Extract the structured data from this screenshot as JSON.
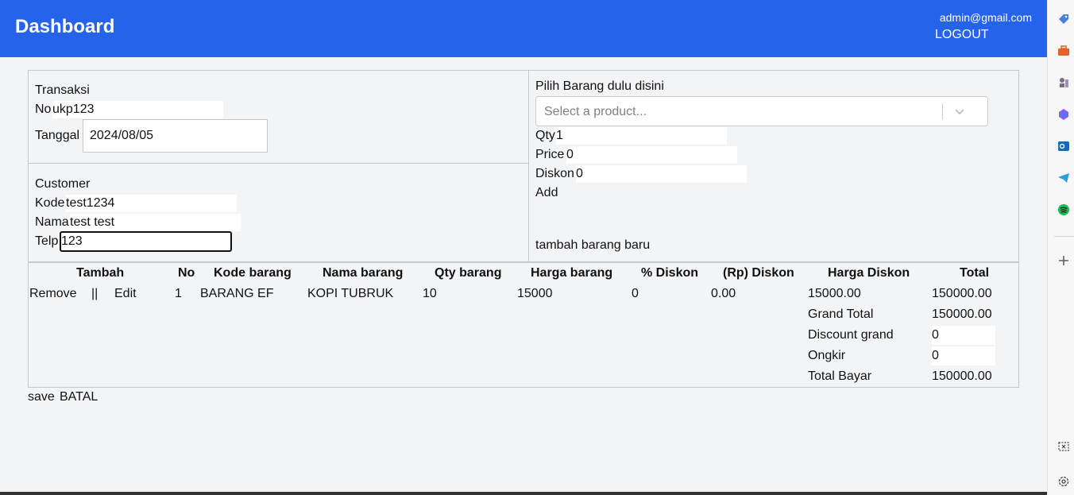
{
  "header": {
    "title": "Dashboard",
    "email": "admin@gmail.com",
    "logout": "LOGOUT"
  },
  "transaction": {
    "section_label": "Transaksi",
    "no_label": "No",
    "no_value": "ukp123",
    "date_label": "Tanggal",
    "date_value": "2024/08/05"
  },
  "customer": {
    "section_label": "Customer",
    "kode_label": "Kode",
    "kode_value": "test1234",
    "nama_label": "Nama",
    "nama_value": "test test",
    "telp_label": "Telp",
    "telp_value": "123"
  },
  "product": {
    "section_label": "Pilih Barang dulu disini",
    "select_placeholder": "Select a product...",
    "qty_label": "Qty",
    "qty_value": "1",
    "price_label": "Price",
    "price_value": "0",
    "diskon_label": "Diskon",
    "diskon_value": "0",
    "add_label": "Add",
    "new_item_label": "tambah barang baru"
  },
  "table": {
    "headers": [
      "Tambah",
      "No",
      "Kode barang",
      "Nama barang",
      "Qty barang",
      "Harga barang",
      "% Diskon",
      "(Rp) Diskon",
      "Harga Diskon",
      "Total"
    ],
    "rows": [
      {
        "remove": "Remove",
        "separator": "||",
        "edit": "Edit",
        "no": "1",
        "kode": "BARANG EF",
        "nama": "KOPI TUBRUK",
        "qty": "10",
        "harga": "15000",
        "diskon_pct": "0",
        "diskon_rp": "0.00",
        "harga_diskon": "15000.00",
        "total": "150000.00"
      }
    ]
  },
  "summary": {
    "grand_total_label": "Grand Total",
    "grand_total_value": "150000.00",
    "discount_grand_label": "Discount grand",
    "discount_grand_value": "0",
    "ongkir_label": "Ongkir",
    "ongkir_value": "0",
    "total_bayar_label": "Total Bayar",
    "total_bayar_value": "150000.00"
  },
  "actions": {
    "save": "save",
    "cancel": "BATAL"
  },
  "colors": {
    "header_bg": "#2563eb",
    "page_bg": "#f3f4f6"
  },
  "edge_icons": [
    "tag-icon",
    "briefcase-icon",
    "chess-icon",
    "copilot-icon",
    "outlook-icon",
    "telegram-icon",
    "spotify-icon",
    "plus-icon",
    "screenshot-icon",
    "settings-icon"
  ]
}
